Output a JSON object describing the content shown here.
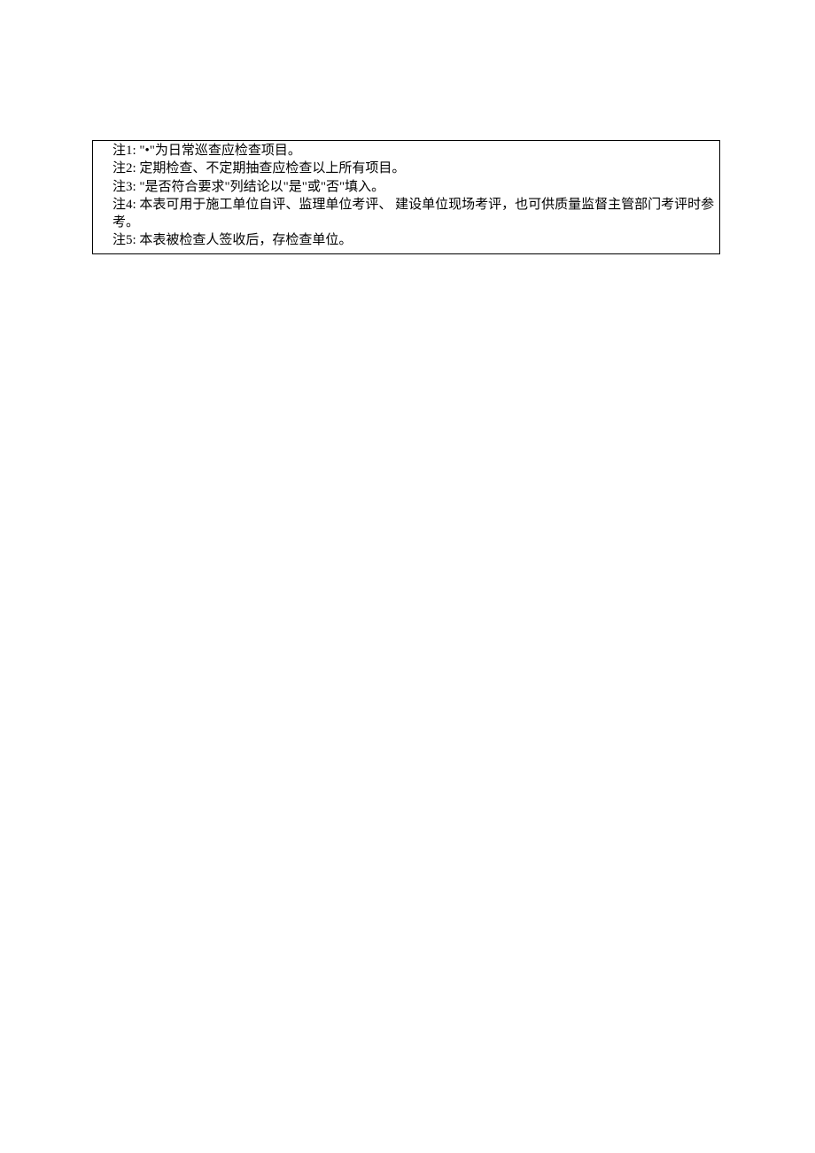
{
  "notes": {
    "items": [
      {
        "label": "注1:",
        "text": "\"•\"为日常巡查应检查项目。"
      },
      {
        "label": "注2:",
        "text": "定期检查、不定期抽查应检查以上所有项目。"
      },
      {
        "label": "注3:",
        "text": " \"是否符合要求\"列结论以\"是\"或\"否\"填入。"
      },
      {
        "label": "注4:",
        "text": "本表可用于施工单位自评、监理单位考评、 建设单位现场考评，也可供质量监督主管部门考评时参考。"
      },
      {
        "label": "注5:",
        "text": "本表被检查人签收后，存检查单位。"
      }
    ]
  }
}
